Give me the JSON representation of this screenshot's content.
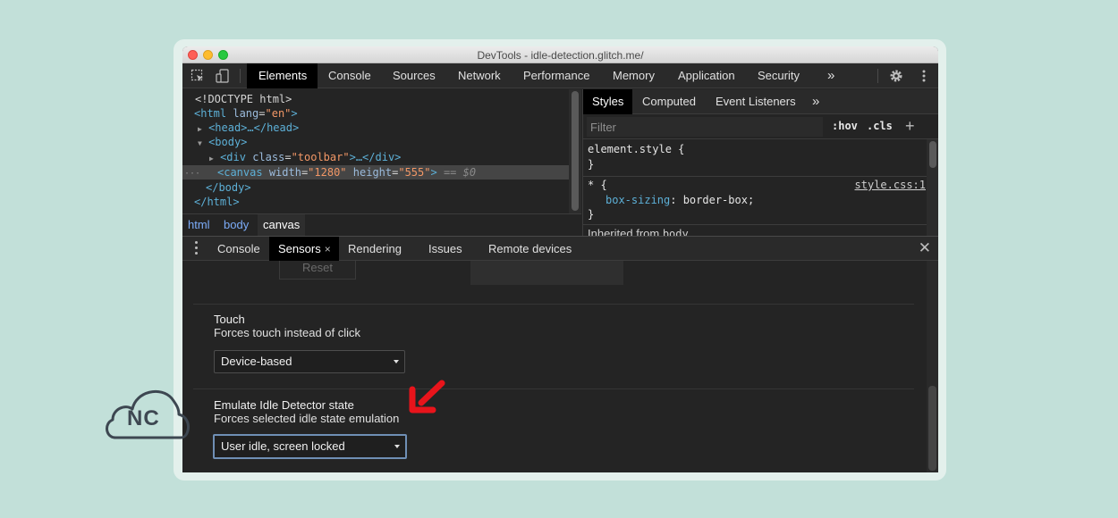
{
  "window": {
    "title": "DevTools - idle-detection.glitch.me/"
  },
  "main_tabs": [
    {
      "label": "Elements",
      "active": true
    },
    {
      "label": "Console",
      "active": false
    },
    {
      "label": "Sources",
      "active": false
    },
    {
      "label": "Network",
      "active": false
    },
    {
      "label": "Performance",
      "active": false
    },
    {
      "label": "Memory",
      "active": false
    },
    {
      "label": "Application",
      "active": false
    },
    {
      "label": "Security",
      "active": false
    }
  ],
  "main_more": "»",
  "dom": {
    "doctype": "<!DOCTYPE html>",
    "html_open": {
      "tag": "<html",
      "attr": "lang",
      "val": "\"en\"",
      "close": ">"
    },
    "head": "<head>…</head>",
    "body_open": "<body>",
    "div_line": {
      "tag": "<div",
      "attr": "class",
      "val": "\"toolbar\"",
      "close": ">…</div>"
    },
    "canvas_line": {
      "tag": "<canvas",
      "attr1": "width",
      "val1": "\"1280\"",
      "attr2": "height",
      "val2": "\"555\"",
      "close": ">",
      "suffix": " == $0"
    },
    "ellipsis": "···",
    "body_close": "</body>",
    "html_close": "</html>"
  },
  "breadcrumbs": [
    {
      "label": "html",
      "active": false
    },
    {
      "label": "body",
      "active": false
    },
    {
      "label": "canvas",
      "active": true
    }
  ],
  "styles_tabs": [
    {
      "label": "Styles",
      "active": true
    },
    {
      "label": "Computed",
      "active": false
    },
    {
      "label": "Event Listeners",
      "active": false
    }
  ],
  "styles_more": "»",
  "styles": {
    "filter_placeholder": "Filter",
    "hov": ":hov",
    "cls": ".cls",
    "plus": "+",
    "element_style_open": "element.style {",
    "element_style_close": "}",
    "rule_selector": "* {",
    "rule_prop": "box-sizing",
    "rule_value": ": border-box;",
    "rule_close": "}",
    "rule_source": "style.css:1",
    "inherited_prefix": "Inherited from ",
    "inherited_from": "body"
  },
  "drawer_tabs": [
    {
      "label": "Console",
      "active": false
    },
    {
      "label": "Sensors",
      "active": true,
      "closable": true
    },
    {
      "label": "Rendering",
      "active": false
    },
    {
      "label": "Issues",
      "active": false
    },
    {
      "label": "Remote devices",
      "active": false
    }
  ],
  "drawer_tab_close": "×",
  "drawer_close": "✕",
  "sensors": {
    "reset_label": "Reset",
    "touch": {
      "title": "Touch",
      "description": "Forces touch instead of click",
      "selected": "Device-based"
    },
    "idle": {
      "title": "Emulate Idle Detector state",
      "description": "Forces selected idle state emulation",
      "selected": "User idle, screen locked"
    }
  },
  "logo": {
    "text": "NC"
  },
  "colors": {
    "background": "#c2e0d9",
    "arrow": "#e8141b",
    "accent_link": "#7cacf8"
  }
}
